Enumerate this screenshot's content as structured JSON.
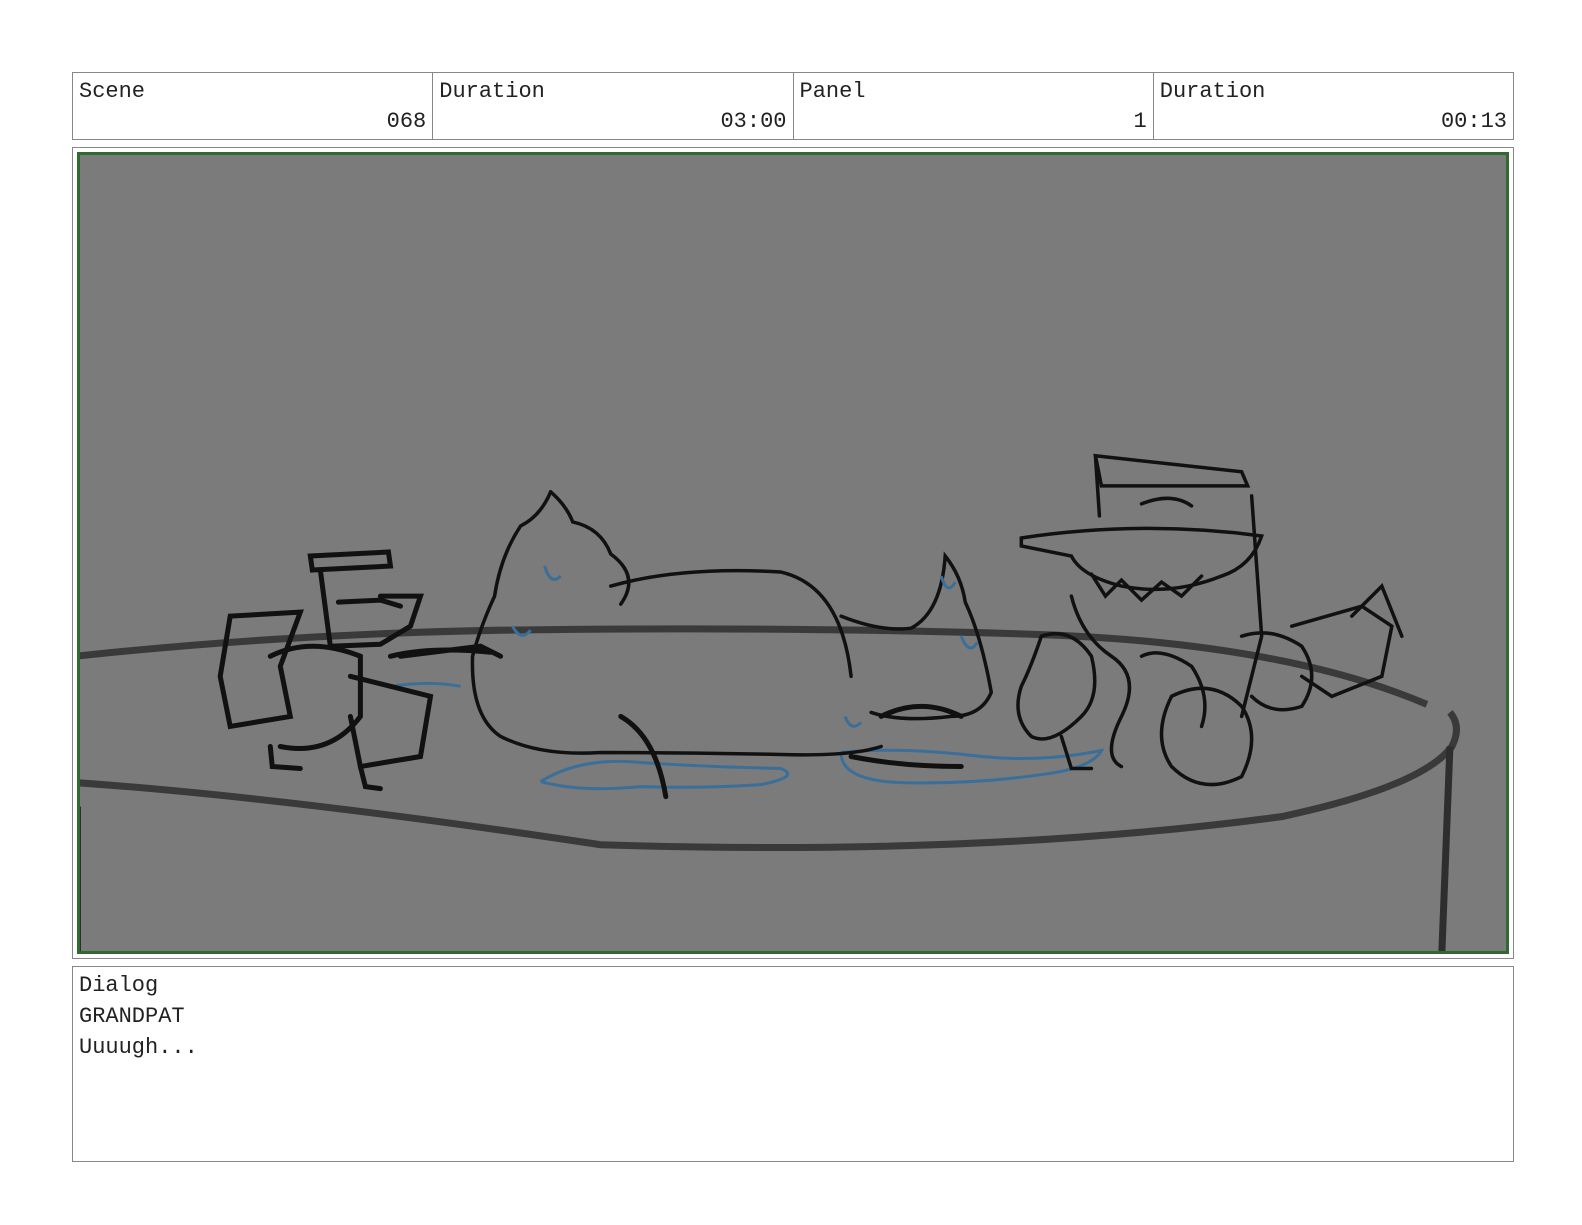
{
  "header": {
    "scene_label": "Scene",
    "scene_value": "068",
    "scene_duration_label": "Duration",
    "scene_duration_value": "03:00",
    "panel_label": "Panel",
    "panel_value": "1",
    "panel_duration_label": "Duration",
    "panel_duration_value": "00:13"
  },
  "panel": {
    "background_color": "#7b7b7b",
    "frame_color": "#2f6a2f",
    "sketch_ink_color": "#111111",
    "water_color": "#3a6f9a"
  },
  "dialog": {
    "label": "Dialog",
    "character": "GRANDPAT",
    "line": "Uuuugh..."
  }
}
